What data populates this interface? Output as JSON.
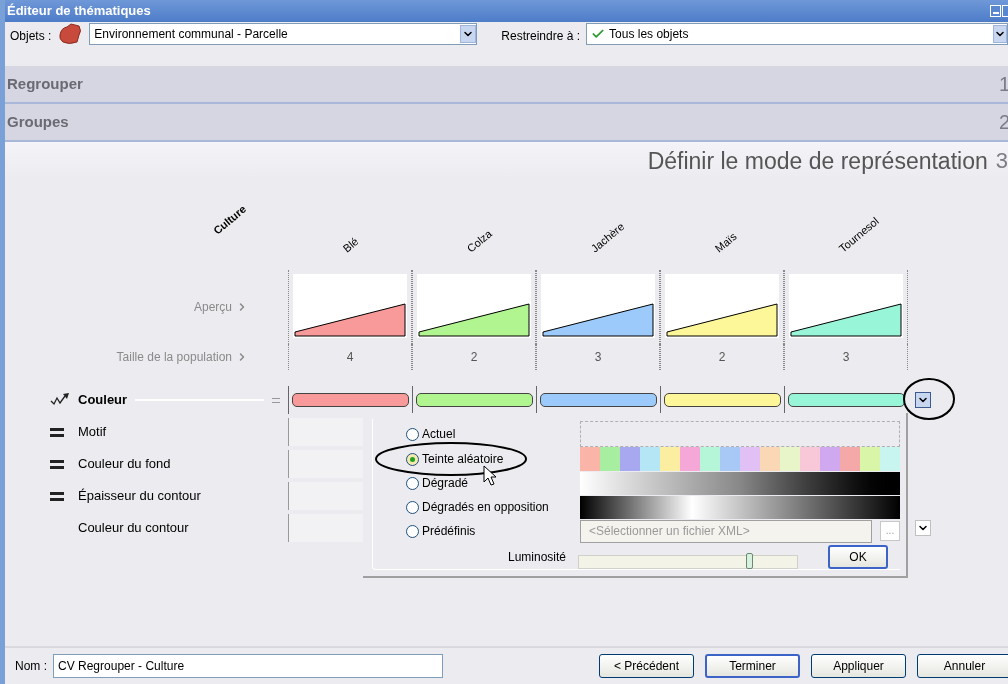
{
  "window": {
    "title": "Éditeur de thématiques"
  },
  "toolbar": {
    "objects_label": "Objets :",
    "objects_value": "Environnement communal - Parcelle",
    "restrict_label": "Restreindre à :",
    "restrict_value": "Tous les objets"
  },
  "sections": [
    {
      "label": "Regrouper",
      "number": "1"
    },
    {
      "label": "Groupes",
      "number": "2"
    }
  ],
  "step": {
    "title": "Définir le mode de représentation",
    "number": "3"
  },
  "grid": {
    "field": "Culture",
    "row_labels": [
      "Aperçu",
      "Taille de la population"
    ],
    "columns": [
      {
        "name": "Blé",
        "color": "#f89a9a",
        "count": "4"
      },
      {
        "name": "Colza",
        "color": "#b0f590",
        "count": "2"
      },
      {
        "name": "Jachère",
        "color": "#9ccafa",
        "count": "3"
      },
      {
        "name": "Maïs",
        "color": "#fdf799",
        "count": "2"
      },
      {
        "name": "Tournesol",
        "color": "#98f5d8",
        "count": "3"
      }
    ]
  },
  "properties": [
    {
      "label": "Couleur",
      "kind": "active",
      "dropdown": true
    },
    {
      "label": "Motif",
      "kind": "linked",
      "dropdown": false
    },
    {
      "label": "Couleur du fond",
      "kind": "linked",
      "dropdown": false
    },
    {
      "label": "Épaisseur du contour",
      "kind": "linked",
      "dropdown": false
    },
    {
      "label": "Couleur du contour",
      "kind": "plain",
      "dropdown": true
    }
  ],
  "popup": {
    "options": [
      {
        "label": "Actuel",
        "selected": false,
        "kind": "empty"
      },
      {
        "label": "Teinte aléatoire",
        "selected": true,
        "kind": "swatches"
      },
      {
        "label": "Dégradé",
        "selected": false,
        "kind": "gradient"
      },
      {
        "label": "Dégradés en opposition",
        "selected": false,
        "kind": "opposition"
      },
      {
        "label": "Prédéfinis",
        "selected": false,
        "kind": "file"
      }
    ],
    "file_placeholder": "<Sélectionner un fichier XML>",
    "browse": "...",
    "brightness_label": "Luminosité",
    "brightness": {
      "level": 0.78
    },
    "ok": "OK"
  },
  "footer": {
    "name_label": "Nom :",
    "name_value": "CV Regrouper - Culture",
    "buttons": [
      {
        "label": "< Précédent",
        "default": false
      },
      {
        "label": "Terminer",
        "default": true
      },
      {
        "label": "Appliquer",
        "default": false
      },
      {
        "label": "Annuler",
        "default": false
      }
    ]
  }
}
